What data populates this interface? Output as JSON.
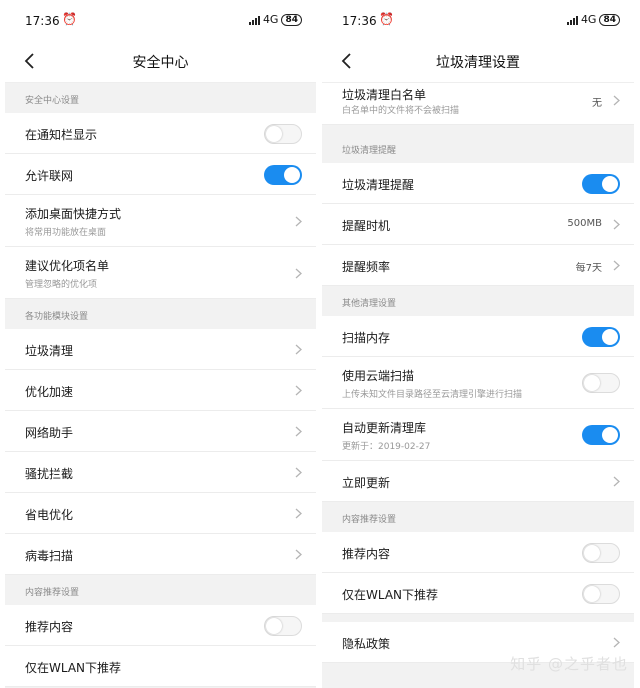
{
  "left": {
    "status_time": "17:36",
    "network": "4G",
    "battery": "84",
    "title": "安全中心",
    "sections": [
      {
        "header": "安全中心设置",
        "rows": [
          {
            "label": "在通知栏显示",
            "toggle": "off"
          },
          {
            "label": "允许联网",
            "toggle": "on"
          },
          {
            "label": "添加桌面快捷方式",
            "sub": "将常用功能放在桌面",
            "chevron": true
          },
          {
            "label": "建议优化项名单",
            "sub": "管理忽略的优化项",
            "chevron": true
          }
        ]
      },
      {
        "header": "各功能模块设置",
        "rows": [
          {
            "label": "垃圾清理",
            "chevron": true
          },
          {
            "label": "优化加速",
            "chevron": true
          },
          {
            "label": "网络助手",
            "chevron": true
          },
          {
            "label": "骚扰拦截",
            "chevron": true
          },
          {
            "label": "省电优化",
            "chevron": true
          },
          {
            "label": "病毒扫描",
            "chevron": true
          }
        ]
      },
      {
        "header": "内容推荐设置",
        "rows": [
          {
            "label": "推荐内容",
            "toggle": "off"
          },
          {
            "label": "仅在WLAN下推荐",
            "toggle": "off"
          }
        ]
      }
    ]
  },
  "right": {
    "status_time": "17:36",
    "network": "4G",
    "battery": "84",
    "title": "垃圾清理设置",
    "top_row": {
      "label": "垃圾清理白名单",
      "sub": "白名单中的文件将不会被扫描",
      "value": "无"
    },
    "sections": [
      {
        "header": "垃圾清理提醒",
        "rows": [
          {
            "label": "垃圾清理提醒",
            "toggle": "on"
          },
          {
            "label": "提醒时机",
            "value": "500MB",
            "chevron": true
          },
          {
            "label": "提醒频率",
            "value": "每7天",
            "chevron": true
          }
        ]
      },
      {
        "header": "其他清理设置",
        "rows": [
          {
            "label": "扫描内存",
            "toggle": "on"
          },
          {
            "label": "使用云端扫描",
            "sub": "上传未知文件目录路径至云清理引擎进行扫描",
            "toggle": "off"
          },
          {
            "label": "自动更新清理库",
            "sub": "更新于：2019-02-27",
            "toggle": "on"
          },
          {
            "label": "立即更新",
            "chevron": true
          }
        ]
      },
      {
        "header": "内容推荐设置",
        "rows": [
          {
            "label": "推荐内容",
            "toggle": "off"
          },
          {
            "label": "仅在WLAN下推荐",
            "toggle": "off"
          }
        ]
      }
    ],
    "bottom_row": {
      "label": "隐私政策"
    }
  },
  "watermark": "知乎 @之乎者也",
  "colors": {
    "accent": "#1a8cf0",
    "background": "#f2f2f2",
    "row": "#ffffff"
  }
}
